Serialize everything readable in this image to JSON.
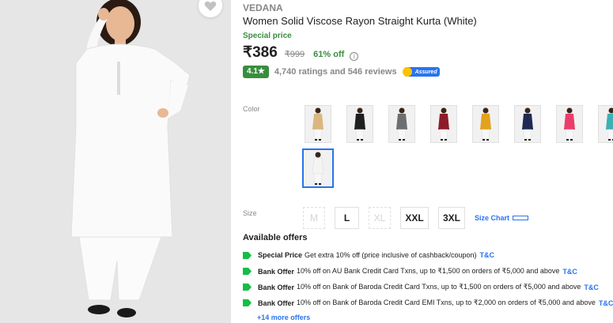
{
  "product": {
    "brand": "VEDANA",
    "title": "Women Solid Viscose Rayon Straight Kurta  (White)",
    "special_price_label": "Special price",
    "price": "₹386",
    "mrp": "₹999",
    "discount": "61% off",
    "info_icon": "i",
    "rating": "4.1★",
    "ratings_reviews": "4,740 ratings and 546 reviews",
    "assured_label": "Assured"
  },
  "colors": {
    "label": "Color",
    "swatches": [
      {
        "name": "beige",
        "color": "#d9b77e"
      },
      {
        "name": "black",
        "color": "#1f1f1f"
      },
      {
        "name": "grey",
        "color": "#6e6e6e"
      },
      {
        "name": "maroon",
        "color": "#8e1b2a"
      },
      {
        "name": "mustard",
        "color": "#e2a21d"
      },
      {
        "name": "navy",
        "color": "#1e2a55"
      },
      {
        "name": "pink",
        "color": "#ea3d6c"
      },
      {
        "name": "teal",
        "color": "#3bb0b5"
      },
      {
        "name": "white",
        "color": "#f4f4f4",
        "selected": true
      }
    ]
  },
  "sizes": {
    "label": "Size",
    "options": [
      {
        "label": "M",
        "available": false
      },
      {
        "label": "L",
        "available": true
      },
      {
        "label": "XL",
        "available": false
      },
      {
        "label": "XXL",
        "available": true
      },
      {
        "label": "3XL",
        "available": true
      }
    ],
    "size_chart": "Size Chart"
  },
  "offers": {
    "title": "Available offers",
    "items": [
      {
        "type": "Special Price",
        "text": "Get extra 10% off (price inclusive of cashback/coupon)",
        "tc": "T&C"
      },
      {
        "type": "Bank Offer",
        "text": "10% off on AU Bank Credit Card Txns, up to ₹1,500 on orders of ₹5,000 and above",
        "tc": "T&C"
      },
      {
        "type": "Bank Offer",
        "text": "10% off on Bank of Baroda Credit Card Txns, up to ₹1,500 on orders of ₹5,000 and above",
        "tc": "T&C"
      },
      {
        "type": "Bank Offer",
        "text": "10% off on Bank of Baroda Credit Card EMI Txns, up to ₹2,000 on orders of ₹5,000 and above",
        "tc": "T&C"
      }
    ],
    "more": "+14 more offers"
  },
  "theme": {
    "accent_blue": "#2874f0",
    "green": "#388e3c",
    "muted_text": "#878787"
  }
}
